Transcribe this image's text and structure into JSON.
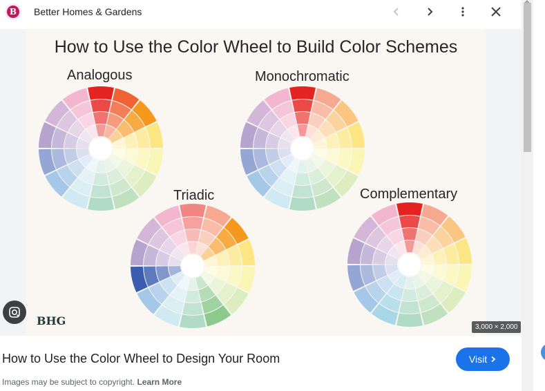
{
  "header": {
    "favicon_letter": "B",
    "source_name": "Better Homes & Gardens",
    "icons": [
      "chevron-left-icon",
      "chevron-right-icon",
      "more-vert-icon",
      "close-icon"
    ]
  },
  "image": {
    "title": "How to Use the Color Wheel to Build Color Schemes",
    "wheels": [
      {
        "label": "Analogous"
      },
      {
        "label": "Monochromatic"
      },
      {
        "label": "Triadic"
      },
      {
        "label": "Complementary"
      }
    ],
    "watermark": "BHG",
    "dimensions": "3,000 × 2,000"
  },
  "result": {
    "caption": "How to Use the Color Wheel to Design Your Room",
    "visit_label": "Visit",
    "copyright_text": "Images may be subject to copyright.",
    "learn_more": "Learn More"
  },
  "colors": {
    "accent": "#1a73e8",
    "favicon": "#c2185b",
    "hues": [
      "#e52421",
      "#ef6335",
      "#f5981b",
      "#f9d21f",
      "#f6ef7b",
      "#bfe08a",
      "#8cc98d",
      "#6dbd9a",
      "#a8d8e8",
      "#5b9bd6",
      "#3a5db0",
      "#7a5aa8",
      "#b07ab8",
      "#e87aa8"
    ]
  },
  "wheel_highlights": {
    "analogous": [
      0,
      1,
      2
    ],
    "monochromatic": [
      0
    ],
    "triadic": [
      2,
      6,
      10
    ],
    "complementary": [
      0,
      8
    ]
  }
}
